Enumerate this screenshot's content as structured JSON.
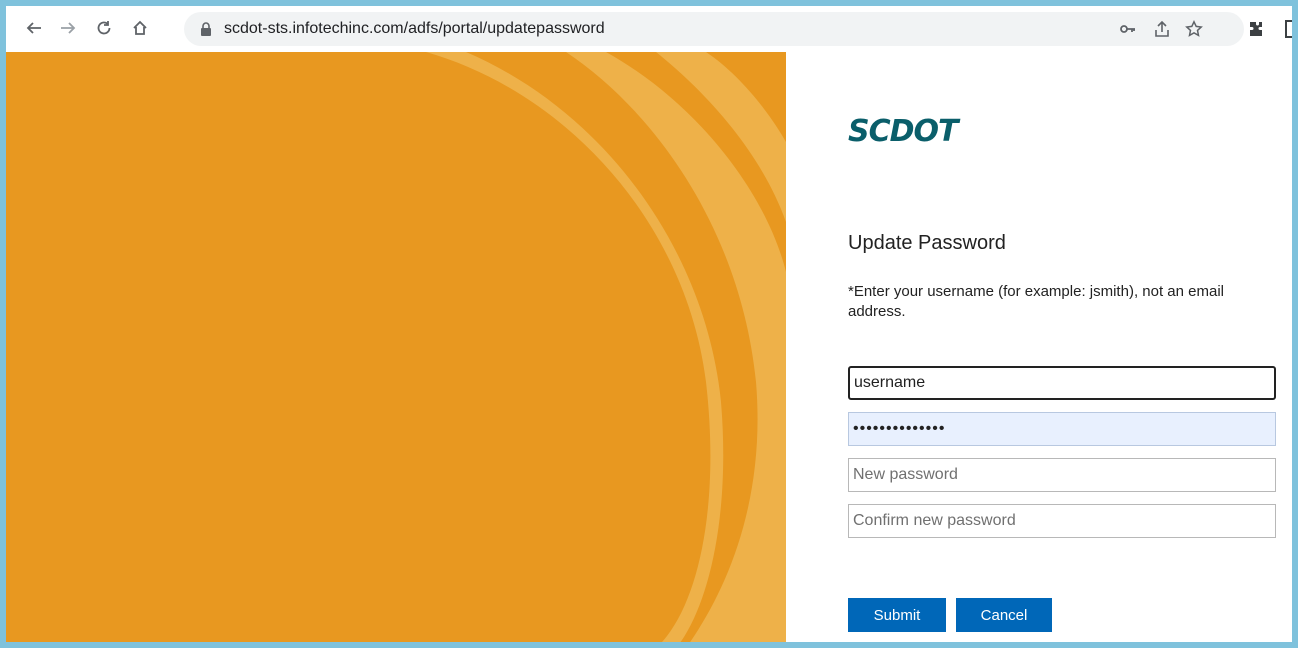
{
  "browser": {
    "url": "scdot-sts.infotechinc.com/adfs/portal/updatepassword",
    "icons": [
      "back-icon",
      "forward-icon",
      "reload-icon",
      "home-icon",
      "lock-icon",
      "key-icon",
      "share-icon",
      "star-icon",
      "extensions-icon"
    ]
  },
  "brand": {
    "logo": "SCDOT",
    "color": "#0a5e6a"
  },
  "form": {
    "title": "Update Password",
    "instructions": "*Enter your username (for example: jsmith), not an email address.",
    "username_value": "username",
    "old_password_value": "••••••••••••••",
    "new_password_placeholder": "New password",
    "confirm_password_placeholder": "Confirm new password",
    "submit_label": "Submit",
    "cancel_label": "Cancel"
  },
  "colors": {
    "accent": "#0067b8",
    "illustration_orange": "#e89820",
    "illustration_light": "#eeb44e",
    "frame": "#7fc2dc"
  }
}
